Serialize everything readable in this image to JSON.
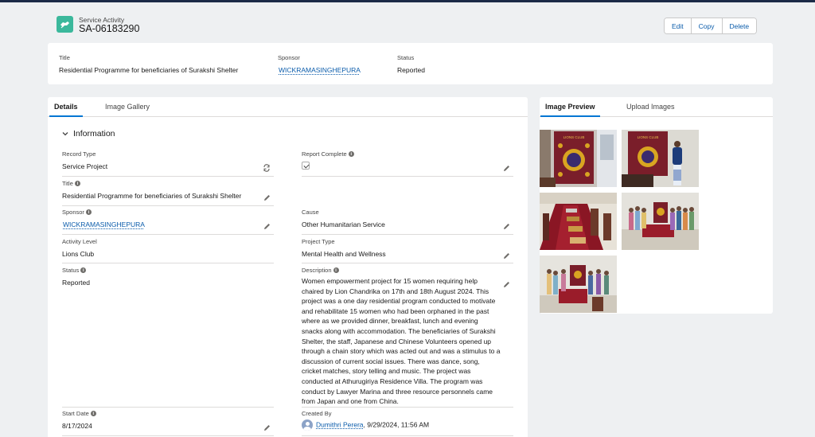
{
  "header": {
    "object_type": "Service Activity",
    "record_name": "SA-06183290",
    "icon": "service-activity-icon",
    "actions": {
      "edit": "Edit",
      "copy": "Copy",
      "delete": "Delete"
    }
  },
  "highlights": {
    "title_label": "Title",
    "title_value": "Residential Programme for beneficiaries of Surakshi Shelter",
    "sponsor_label": "Sponsor",
    "sponsor_value": "WICKRAMASINGHEPURA",
    "status_label": "Status",
    "status_value": "Reported"
  },
  "main_tabs": {
    "details": "Details",
    "gallery": "Image Gallery"
  },
  "section": {
    "title": "Information"
  },
  "fields": {
    "record_type_label": "Record Type",
    "record_type_value": "Service Project",
    "report_complete_label": "Report Complete",
    "report_complete_value": true,
    "title_label": "Title",
    "title_value": "Residential Programme for beneficiaries of Surakshi Shelter",
    "sponsor_label": "Sponsor",
    "sponsor_value": "WICKRAMASINGHEPURA",
    "cause_label": "Cause",
    "cause_value": "Other Humanitarian Service",
    "activity_level_label": "Activity Level",
    "activity_level_value": "Lions Club",
    "project_type_label": "Project Type",
    "project_type_value": "Mental Health and Wellness",
    "status_label": "Status",
    "status_value": "Reported",
    "description_label": "Description",
    "description_value": "Women empowerment project for 15 women requiring help chaired by Lion Chandrika on 17th and 18th August 2024. This project was a one day residential program conducted to motivate and rehabilitate 15 women who had been orphaned in the past where as we provided dinner, breakfast, lunch and evening snacks along with accommodation. The beneficiaries of Surakshi Shelter, the staff, Japanese and Chinese Volunteers opened up through a chain story which was acted out and was a stimulus to a discussion of current social issues. There was dance, song, cricket matches, story telling and music. The project was conducted at Athurugiriya Residence Villa. The program was conduct by Lawyer Marina and three resource personnels came from Japan and one from China.",
    "start_date_label": "Start Date",
    "start_date_value": "8/17/2024",
    "created_by_label": "Created By",
    "created_by_name": "Dumithri Perera",
    "created_by_date": ", 9/29/2024, 11:56 AM"
  },
  "side_tabs": {
    "preview": "Image Preview",
    "upload": "Upload Images"
  },
  "colors": {
    "brand": "#0176d3",
    "link": "#0b5cab",
    "icon_bg": "#3bb89c",
    "banner_red": "#7a1e2a"
  }
}
